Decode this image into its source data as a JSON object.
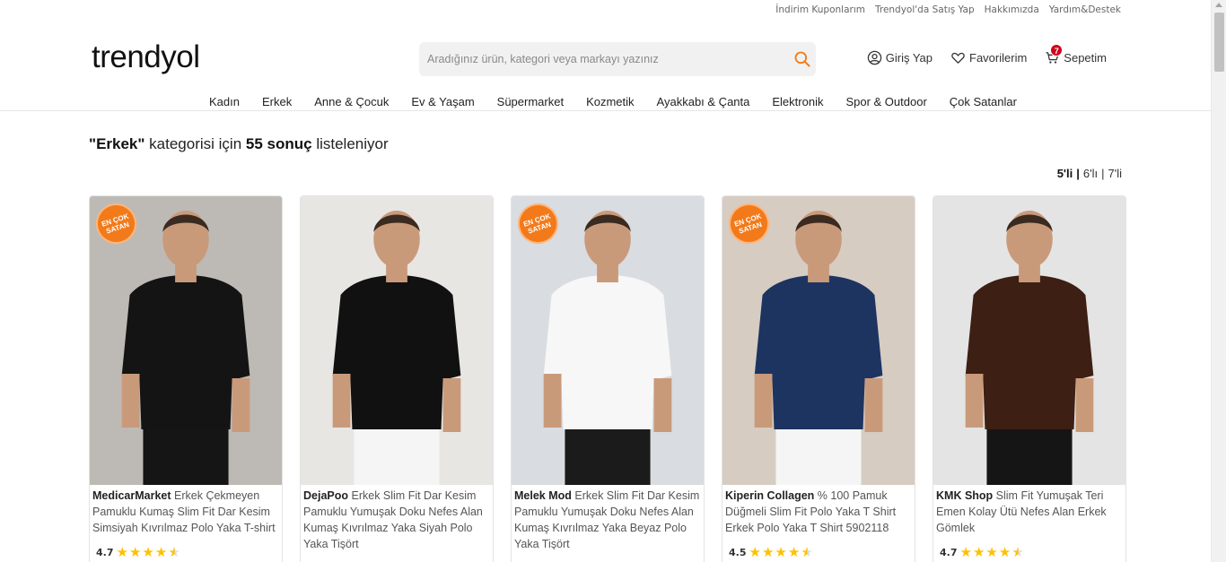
{
  "top_links": [
    "İndirim Kuponlarım",
    "Trendyol'da Satış Yap",
    "Hakkımızda",
    "Yardım&Destek"
  ],
  "logo": "trendyol",
  "search": {
    "placeholder": "Aradığınız ürün, kategori veya markayı yazınız",
    "value": ""
  },
  "user_nav": {
    "login": "Giriş Yap",
    "favorites": "Favorilerim",
    "cart": "Sepetim",
    "cart_count": "7"
  },
  "categories": [
    "Kadın",
    "Erkek",
    "Anne & Çocuk",
    "Ev & Yaşam",
    "Süpermarket",
    "Kozmetik",
    "Ayakkabı & Çanta",
    "Elektronik",
    "Spor & Outdoor",
    "Çok Satanlar"
  ],
  "results": {
    "quote_open": "\"",
    "category": "Erkek",
    "quote_close": "\"",
    "mid": " kategorisi için ",
    "count": "55 sonuç",
    "tail": " listeleniyor"
  },
  "grid_options": [
    "5'li",
    "6'lı",
    "7'li"
  ],
  "grid_sep": "|",
  "products": [
    {
      "brand": "MedicarMarket",
      "title": " Erkek Çekmeyen Pamuklu Kumaş Slim Fit Dar Kesim Simsiyah Kıvrılmaz Polo Yaka T-shirt",
      "rating": "4.7",
      "rating_value": 4.7,
      "best_seller": true,
      "badge_text": "EN ÇOK SATAN",
      "shirt_color": "#141414",
      "bg_color": "#bdbab5"
    },
    {
      "brand": "DejaPoo",
      "title": " Erkek Slim Fit Dar Kesim Pamuklu Yumuşak Doku Nefes Alan Kumaş Kıvrılmaz Yaka Siyah Polo Yaka Tişört",
      "rating": "",
      "rating_value": 0,
      "best_seller": false,
      "badge_text": "",
      "shirt_color": "#111111",
      "bg_color": "#e8e6e3"
    },
    {
      "brand": "Melek Mod",
      "title": " Erkek Slim Fit Dar Kesim Pamuklu Yumuşak Doku Nefes Alan Kumaş Kıvrılmaz Yaka Beyaz Polo Yaka Tişört",
      "rating": "",
      "rating_value": 0,
      "best_seller": true,
      "badge_text": "EN ÇOK SATAN",
      "shirt_color": "#f7f7f7",
      "bg_color": "#d9dce0"
    },
    {
      "brand": "Kiperin Collagen",
      "title": " % 100 Pamuk Düğmeli Slim Fit Polo Yaka T Shirt Erkek Polo Yaka T Shirt 5902118",
      "rating": "4.5",
      "rating_value": 4.5,
      "best_seller": true,
      "badge_text": "EN ÇOK SATAN",
      "shirt_color": "#1d3461",
      "bg_color": "#d6ccc2"
    },
    {
      "brand": "KMK Shop",
      "title": " Slim Fit Yumuşak Teri Emen Kolay Ütü Nefes Alan Erkek Gömlek",
      "rating": "4.7",
      "rating_value": 4.7,
      "best_seller": false,
      "badge_text": "",
      "shirt_color": "#3d1f14",
      "bg_color": "#e4e4e4"
    }
  ],
  "colors": {
    "accent": "#f27a1a",
    "cart_badge": "#d0021b",
    "star": "#ffc000"
  }
}
